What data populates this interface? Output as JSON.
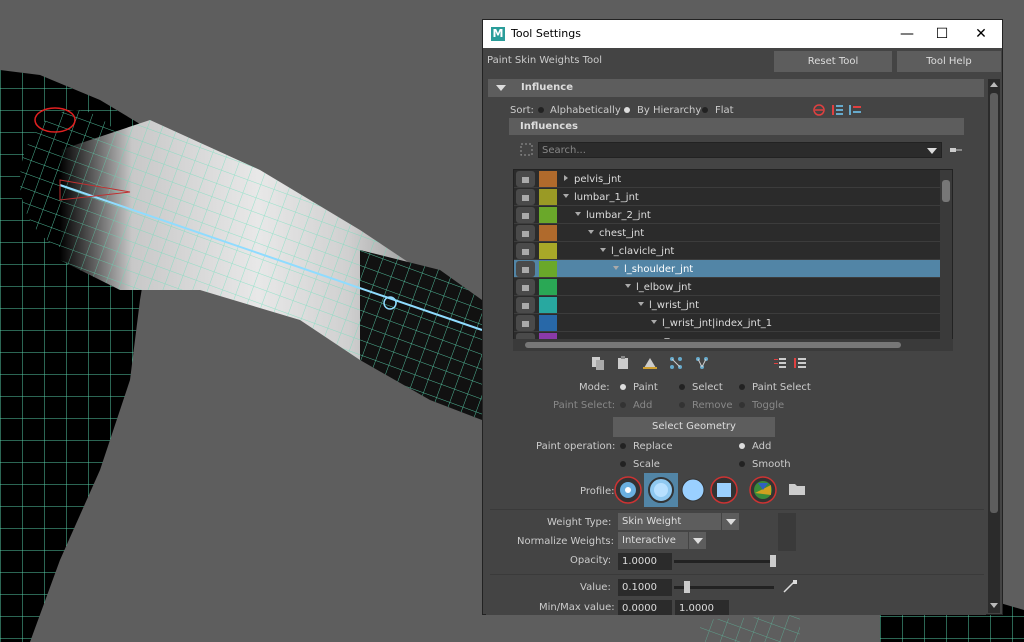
{
  "window": {
    "title": "Tool Settings",
    "app_icon": "M",
    "minimize": "—",
    "maximize": "☐",
    "close": "✕"
  },
  "header": {
    "tool_name": "Paint Skin Weights Tool",
    "reset_label": "Reset Tool",
    "help_label": "Tool Help"
  },
  "influence": {
    "section_label": "Influence",
    "sort_label": "Sort:",
    "sort_options": [
      "Alphabetically",
      "By Hierarchy",
      "Flat"
    ],
    "sort_selected": "By Hierarchy",
    "influences_label": "Influences",
    "search_placeholder": "Search...",
    "joints": [
      {
        "name": "pelvis_jnt",
        "color": "#b06a2c",
        "depth": 0,
        "expander": "collapsed"
      },
      {
        "name": "lumbar_1_jnt",
        "color": "#9a9a25",
        "depth": 0,
        "expander": "expanded"
      },
      {
        "name": "lumbar_2_jnt",
        "color": "#6aa82a",
        "depth": 1,
        "expander": "expanded"
      },
      {
        "name": "chest_jnt",
        "color": "#b06a2c",
        "depth": 2,
        "expander": "expanded"
      },
      {
        "name": "l_clavicle_jnt",
        "color": "#a8a828",
        "depth": 3,
        "expander": "expanded"
      },
      {
        "name": "l_shoulder_jnt",
        "color": "#6aa82a",
        "depth": 4,
        "expander": "expanded",
        "selected": true
      },
      {
        "name": "l_elbow_jnt",
        "color": "#2aa855",
        "depth": 5,
        "expander": "expanded"
      },
      {
        "name": "l_wrist_jnt",
        "color": "#28a8a0",
        "depth": 6,
        "expander": "expanded"
      },
      {
        "name": "l_wrist_jnt|index_jnt_1",
        "color": "#2868a8",
        "depth": 7,
        "expander": "expanded"
      },
      {
        "name": "",
        "color": "#8a3aa8",
        "depth": 8,
        "expander": "expanded"
      }
    ]
  },
  "mode": {
    "label": "Mode:",
    "options": [
      "Paint",
      "Select",
      "Paint Select"
    ],
    "selected": "Paint",
    "paint_select_label": "Paint Select:",
    "paint_select_options": [
      "Add",
      "Remove",
      "Toggle"
    ],
    "select_geometry": "Select Geometry"
  },
  "paint_operation": {
    "label": "Paint operation:",
    "options": [
      "Replace",
      "Add",
      "Scale",
      "Smooth"
    ],
    "selected": "Add"
  },
  "profile": {
    "label": "Profile:"
  },
  "weights": {
    "weight_type_label": "Weight Type:",
    "weight_type_value": "Skin Weight",
    "normalize_label": "Normalize Weights:",
    "normalize_value": "Interactive",
    "opacity_label": "Opacity:",
    "opacity_value": "1.0000",
    "opacity_level": 1.0,
    "value_label": "Value:",
    "value_value": "0.1000",
    "value_level": 0.1,
    "minmax_label": "Min/Max value:",
    "min_value": "0.0000",
    "max_value": "1.0000"
  },
  "colors": {
    "selection": "#5285a6",
    "wire": "#5fe0b8"
  }
}
